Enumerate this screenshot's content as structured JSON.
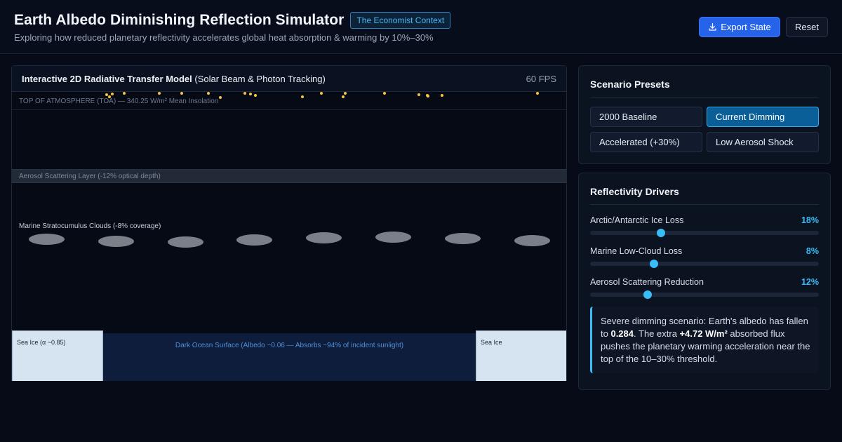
{
  "header": {
    "title": "Earth Albedo Diminishing Reflection Simulator",
    "badge": "The Economist Context",
    "subtitle": "Exploring how reduced planetary reflectivity accelerates global heat absorption & warming by 10%–30%",
    "export_label": "Export State",
    "reset_label": "Reset"
  },
  "simulation": {
    "title_bold": "Interactive 2D Radiative Transfer Model",
    "title_rest": " (Solar Beam & Photon Tracking)",
    "fps": "60 FPS",
    "toa_label": "TOP OF ATMOSPHERE (TOA) — 340.25 W/m² Mean Insolation",
    "aerosol_label": "Aerosol Scattering Layer (-12% optical depth)",
    "cloud_label": "Marine Stratocumulus Clouds (-8% coverage)",
    "cloud_count": 8,
    "sea_ice_left_label": "Sea Ice (α ~0.85)",
    "sea_ice_right_label": "Sea Ice",
    "ocean_label": "Dark Ocean Surface (Albedo ~0.06 — Absorbs ~94% of incident sunlight)",
    "photon_color": "#f5c542"
  },
  "presets": {
    "title": "Scenario Presets",
    "items": [
      {
        "label": "2000 Baseline",
        "active": false
      },
      {
        "label": "Current Dimming",
        "active": true
      },
      {
        "label": "Accelerated (+30%)",
        "active": false
      },
      {
        "label": "Low Aerosol Shock",
        "active": false
      }
    ]
  },
  "drivers": {
    "title": "Reflectivity Drivers",
    "items": [
      {
        "label": "Arctic/Antarctic Ice Loss",
        "value_text": "18%",
        "level": 0.31
      },
      {
        "label": "Marine Low-Cloud Loss",
        "value_text": "8%",
        "level": 0.28
      },
      {
        "label": "Aerosol Scattering Reduction",
        "value_text": "12%",
        "level": 0.25
      }
    ],
    "note": {
      "part1": "Severe dimming scenario: Earth's albedo has fallen to ",
      "albedo": "0.284",
      "part2": ". The extra ",
      "flux": "+4.72 W/m²",
      "part3": " absorbed flux pushes the planetary warming acceleration near the top of the 10–30% threshold."
    }
  },
  "colors": {
    "accent": "#38bdf8",
    "primary_button": "#2563eb",
    "active_preset": "#0a5f98"
  }
}
